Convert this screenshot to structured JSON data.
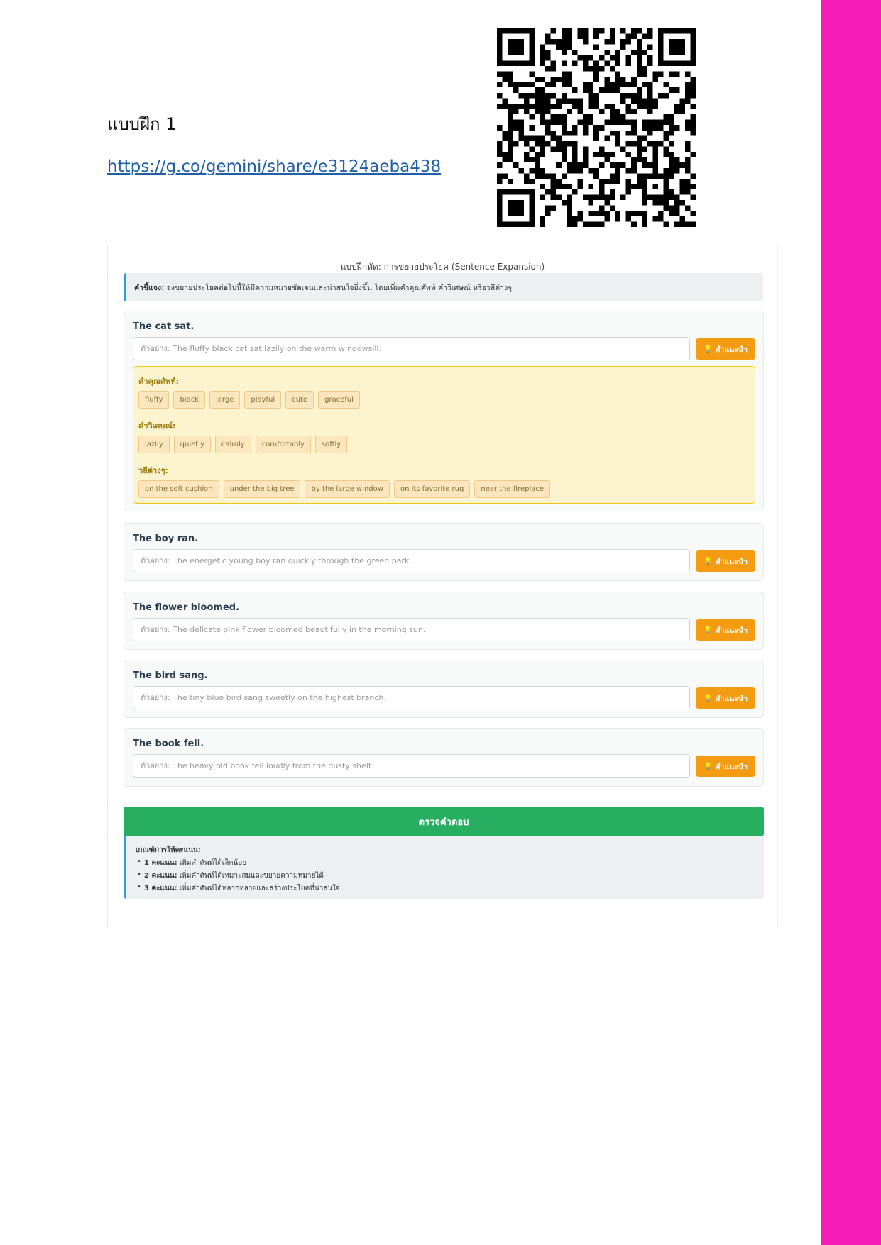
{
  "page": {
    "title": "แบบฝึก 1",
    "link": "https://g.co/gemini/share/e3124aeba438",
    "colors": {
      "side_bar": "#f41cb4",
      "link": "#1f5fa8"
    }
  },
  "app": {
    "title": "แบบฝึกหัด: การขยายประโยค (Sentence Expansion)",
    "instructions_label": "คำชี้แจง:",
    "instructions_text": "จงขยายประโยคต่อไปนี้ให้มีความหมายชัดเจนและน่าสนใจยิ่งขึ้น โดยเพิ่มคำคุณศัพท์ คำวิเศษณ์ หรือวลีต่างๆ",
    "hint_label": "คำแนะนำ",
    "bulb_icon": "💡",
    "cards": [
      {
        "sentence": "The cat sat.",
        "placeholder": "ตัวอย่าง: The fluffy black cat sat lazily on the warm windowsill.",
        "hints": {
          "adjectives_label": "คำคุณศัพท์:",
          "adjectives": [
            "fluffy",
            "black",
            "large",
            "playful",
            "cute",
            "graceful"
          ],
          "adverbs_label": "คำวิเศษณ์:",
          "adverbs": [
            "lazily",
            "quietly",
            "calmly",
            "comfortably",
            "softly"
          ],
          "phrases_label": "วลีต่างๆ:",
          "phrases": [
            "on the soft cushion",
            "under the big tree",
            "by the large window",
            "on its favorite rug",
            "near the fireplace"
          ]
        }
      },
      {
        "sentence": "The boy ran.",
        "placeholder": "ตัวอย่าง: The energetic young boy ran quickly through the green park."
      },
      {
        "sentence": "The flower bloomed.",
        "placeholder": "ตัวอย่าง: The delicate pink flower bloomed beautifully in the morning sun."
      },
      {
        "sentence": "The bird sang.",
        "placeholder": "ตัวอย่าง: The tiny blue bird sang sweetly on the highest branch."
      },
      {
        "sentence": "The book fell.",
        "placeholder": "ตัวอย่าง: The heavy old book fell loudly from the dusty shelf."
      }
    ],
    "check_button": "ตรวจคำตอบ",
    "criteria": {
      "title": "เกณฑ์การให้คะแนน:",
      "items": [
        {
          "score": "1 คะแนน:",
          "text": "เพิ่มคำศัพท์ได้เล็กน้อย"
        },
        {
          "score": "2 คะแนน:",
          "text": "เพิ่มคำศัพท์ได้เหมาะสมและขยายความหมายได้"
        },
        {
          "score": "3 คะแนน:",
          "text": "เพิ่มคำศัพท์ได้หลากหลายและสร้างประโยคที่น่าสนใจ"
        }
      ]
    },
    "colors": {
      "hint_button": "#f39c12",
      "check_button": "#27ae60",
      "accent": "#3498db",
      "hint_panel": "#fcf3cf"
    }
  }
}
